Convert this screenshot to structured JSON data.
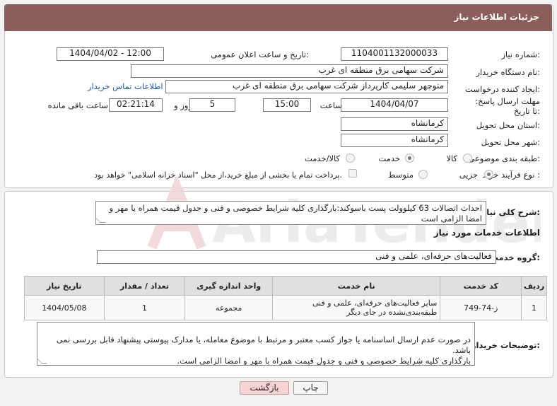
{
  "header": {
    "title": "جزئیات اطلاعات نیاز"
  },
  "labels": {
    "need_number": "شماره نیاز:",
    "announce_datetime": "تاریخ و ساعت اعلان عمومی:",
    "buyer_org": "نام دستگاه خریدار:",
    "requester": "ایجاد کننده درخواست:",
    "deadline": "مهلت ارسال پاسخ: تا تاریخ:",
    "time": "ساعت",
    "days_and": "روز و",
    "remaining": "ساعت باقی مانده",
    "province": "استان محل تحویل:",
    "city": "شهر محل تحویل:",
    "category": "طبقه بندی موضوعی:",
    "process": "نوع فرآیند خرید :",
    "description": "شرح کلی نیاز:",
    "services_info": "اطلاعات خدمات مورد نیاز",
    "service_group": "گروه خدمت:",
    "buyer_notes": "توضیحات خریدار:"
  },
  "fields": {
    "need_number": "1104001132000033",
    "announce_datetime": "1404/04/02 - 12:00",
    "buyer_org": "شرکت سهامی برق منطقه ای غرب",
    "requester": "منوچهر  سلیمی کارپرداز شرکت سهامی برق منطقه ای غرب",
    "contact_link": "اطلاعات تماس خریدار",
    "deadline_date": "1404/04/07",
    "deadline_time": "15:00",
    "days": "5",
    "remaining_time": "02:21:14",
    "province": "کرمانشاه",
    "city": "کرمانشاه",
    "description": "احداث اتصالات 63 کیلوولت پست باسوکند:بارگذاری کلیه شرایط خصوصی و فنی و جدول قیمت همراه با مهر و امضا الزامی است",
    "service_group": "فعالیت‌های حرفه‌ای، علمی و فنی",
    "buyer_notes": "در صورت عدم ارسال اساسنامه یا جواز کسب معتبر و مرتبط با موضوع معامله،  یا مدارک پیوستی پیشنهاد قابل بررسی نمی باشد.\nبارگذاری کلیه شرایط خصوصی و فنی و جدول قیمت همراه با مهر و امضا الزامی است."
  },
  "category_options": [
    {
      "label": "کالا",
      "selected": false
    },
    {
      "label": "خدمت",
      "selected": true
    },
    {
      "label": "کالا/خدمت",
      "selected": false
    }
  ],
  "process_options": [
    {
      "label": "جزیی",
      "selected": true
    },
    {
      "label": "متوسط",
      "selected": false
    }
  ],
  "treasury_note": "پرداخت تمام یا بخشی از مبلغ خرید،از محل \"اسناد خزانه اسلامی\" خواهد بود.",
  "table": {
    "headers": [
      "ردیف",
      "کد خدمت",
      "نام خدمت",
      "واحد اندازه گیری",
      "تعداد / مقدار",
      "تاریخ نیاز"
    ],
    "rows": [
      [
        "1",
        "ز-74-749",
        "سایر فعالیت‌های حرفه‌ای، علمی و فنی طبقه‌بندی‌نشده در جای دیگر",
        "مجموعه",
        "1",
        "1404/05/08"
      ]
    ]
  },
  "buttons": {
    "print": "چاپ",
    "back": "بازگشت"
  },
  "watermark": "AriaTender.neT",
  "colors": {
    "header_bg": "#8b5f59",
    "link": "#1a58b5",
    "back_button": "#f7d3d3"
  }
}
